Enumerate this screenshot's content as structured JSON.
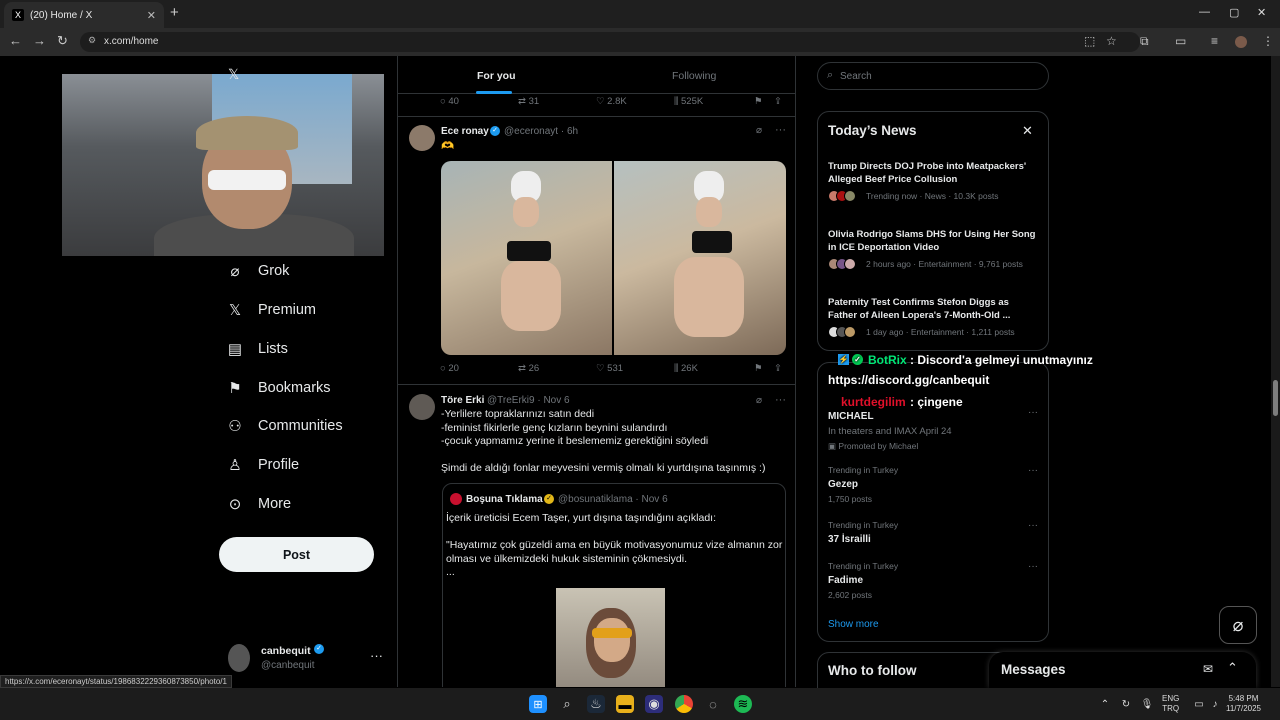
{
  "browser": {
    "tab_title": "(20) Home / X",
    "tab_favicon": "X",
    "tab_close": "✕",
    "new_tab": "+",
    "url": "x.com/home",
    "status_url": "https://x.com/eceronayt/status/1986832229360873850/photo/1",
    "window_controls": [
      "—",
      "▢",
      "✕"
    ]
  },
  "left_nav": {
    "items": [
      {
        "label": "Grok",
        "icon": "grok-icon",
        "glyph": "⌀"
      },
      {
        "label": "Premium",
        "icon": "x-logo-icon",
        "glyph": "𝕏"
      },
      {
        "label": "Lists",
        "icon": "lists-icon",
        "glyph": "▤"
      },
      {
        "label": "Bookmarks",
        "icon": "bookmark-icon",
        "glyph": "⚑"
      },
      {
        "label": "Communities",
        "icon": "communities-icon",
        "glyph": "⚇"
      },
      {
        "label": "Profile",
        "icon": "profile-icon",
        "glyph": "♙"
      },
      {
        "label": "More",
        "icon": "more-circle-icon",
        "glyph": "⊙"
      }
    ],
    "post_button": "Post",
    "account": {
      "name": "canbequit",
      "handle": "@canbequit",
      "more": "···"
    }
  },
  "feed": {
    "tabs": [
      "For you",
      "Following"
    ],
    "active_tab": "For you",
    "prev_actions": {
      "replies": "40",
      "reposts": "31",
      "likes": "2.8K",
      "views": "525K"
    },
    "tweets": [
      {
        "name": "Ece ronay",
        "handle": "@eceronayt · 6h",
        "text": "🫶",
        "actions": {
          "replies": "20",
          "reposts": "26",
          "likes": "531",
          "views": "26K"
        }
      },
      {
        "name": "Töre Erki",
        "handle": "@TreErki9 · Nov 6",
        "text": "-Yerlilere topraklarınızı satın dedi\n-feminist fikirlerle genç kızların beynini sulandırdı\n-çocuk yapmamız yerine it beslememiz gerektiğini söyledi\n\nŞimdi de aldığı fonlar meyvesini vermiş olmalı ki yurtdışına taşınmış :)",
        "quote": {
          "name": "Boşuna Tıklama",
          "handle": "@bosunatiklama · Nov 6",
          "text": "İçerik üreticisi Ecem Taşer, yurt dışına taşındığını açıkladı:\n\n\"Hayatımız çok güzeldi ama en büyük motivasyonumuz vize almanın zor\nolması ve ülkemizdeki hukuk sisteminin çökmesiydi.\n..."
        }
      }
    ]
  },
  "right": {
    "search_placeholder": "Search",
    "news": {
      "title": "Today’s News",
      "close": "✕",
      "items": [
        {
          "title": "Trump Directs DOJ Probe into Meatpackers' Alleged Beef Price Collusion",
          "meta": "Trending now · News · 10.3K posts"
        },
        {
          "title": "Olivia Rodrigo Slams DHS for Using Her Song in ICE Deportation Video",
          "meta": "2 hours ago · Entertainment · 9,761 posts"
        },
        {
          "title": "Paternity Test Confirms Stefon Diggs as Father of Aileen Lopera's 7-Month-Old ...",
          "meta": "1 day ago · Entertainment · 1,211 posts"
        }
      ]
    },
    "promoted": {
      "title": "MICHAEL",
      "subtitle": "In theaters and IMAX April 24",
      "meta": "Promoted by Michael"
    },
    "trends": [
      {
        "category": "Trending in Turkey",
        "title": "Gezep",
        "posts": "1,750 posts"
      },
      {
        "category": "Trending in Turkey",
        "title": "37 İsrailli",
        "posts": ""
      },
      {
        "category": "Trending in Turkey",
        "title": "Fadime",
        "posts": "2,602 posts"
      }
    ],
    "show_more": "Show more",
    "who_to_follow": "Who to follow",
    "messages": "Messages"
  },
  "chat_overlay": {
    "line1_user": "BotRix",
    "line1_text": ": Discord'a gelmeyi unutmayınız",
    "line2_text": "https://discord.gg/canbequit",
    "line3_user": "kurtdegilim",
    "line3_text": ": çingene",
    "colors": {
      "botrix": "#00e676",
      "kurtdegilim": "#e0102a"
    }
  },
  "taskbar": {
    "lang": "ENG",
    "lang2": "TRQ",
    "time": "5:48 PM",
    "date": "11/7/2025"
  }
}
